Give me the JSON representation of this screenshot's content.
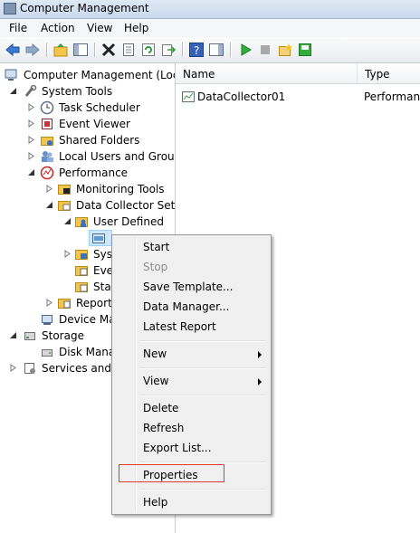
{
  "window": {
    "title": "Computer Management"
  },
  "menubar": {
    "items": [
      "File",
      "Action",
      "View",
      "Help"
    ]
  },
  "toolbar": {
    "buttons": [
      "back-icon",
      "forward-icon",
      "up-folder-icon",
      "show-hide-tree-icon",
      "delete-icon",
      "properties-sheet-icon",
      "refresh-icon",
      "export-list-icon",
      "help-icon",
      "show-hide-action-pane-icon",
      "start-icon",
      "stop-icon",
      "new-collector-icon",
      "save-icon"
    ]
  },
  "tree": {
    "root": "Computer Management (Local",
    "system_tools": "System Tools",
    "task_scheduler": "Task Scheduler",
    "event_viewer": "Event Viewer",
    "shared_folders": "Shared Folders",
    "local_users": "Local Users and Groups",
    "performance": "Performance",
    "monitoring_tools": "Monitoring Tools",
    "data_collector_sets": "Data Collector Sets",
    "user_defined": "User Defined",
    "system": "Syst",
    "event_trace": "Even",
    "startup": "Star",
    "reports": "Reports",
    "device_manager": "Device Man",
    "storage": "Storage",
    "disk_management": "Disk Manag",
    "services_apps": "Services and A"
  },
  "list": {
    "columns": [
      "Name",
      "Type"
    ],
    "rows": [
      {
        "name": "DataCollector01",
        "type": "Performance"
      }
    ]
  },
  "context_menu": {
    "start": "Start",
    "stop": "Stop",
    "save_template": "Save Template...",
    "data_manager": "Data Manager...",
    "latest_report": "Latest Report",
    "new": "New",
    "view": "View",
    "delete": "Delete",
    "refresh": "Refresh",
    "export_list": "Export List...",
    "properties": "Properties",
    "help": "Help"
  },
  "colors": {
    "highlight_border": "#e23a3a",
    "tree_selection": "#cce8ff"
  }
}
